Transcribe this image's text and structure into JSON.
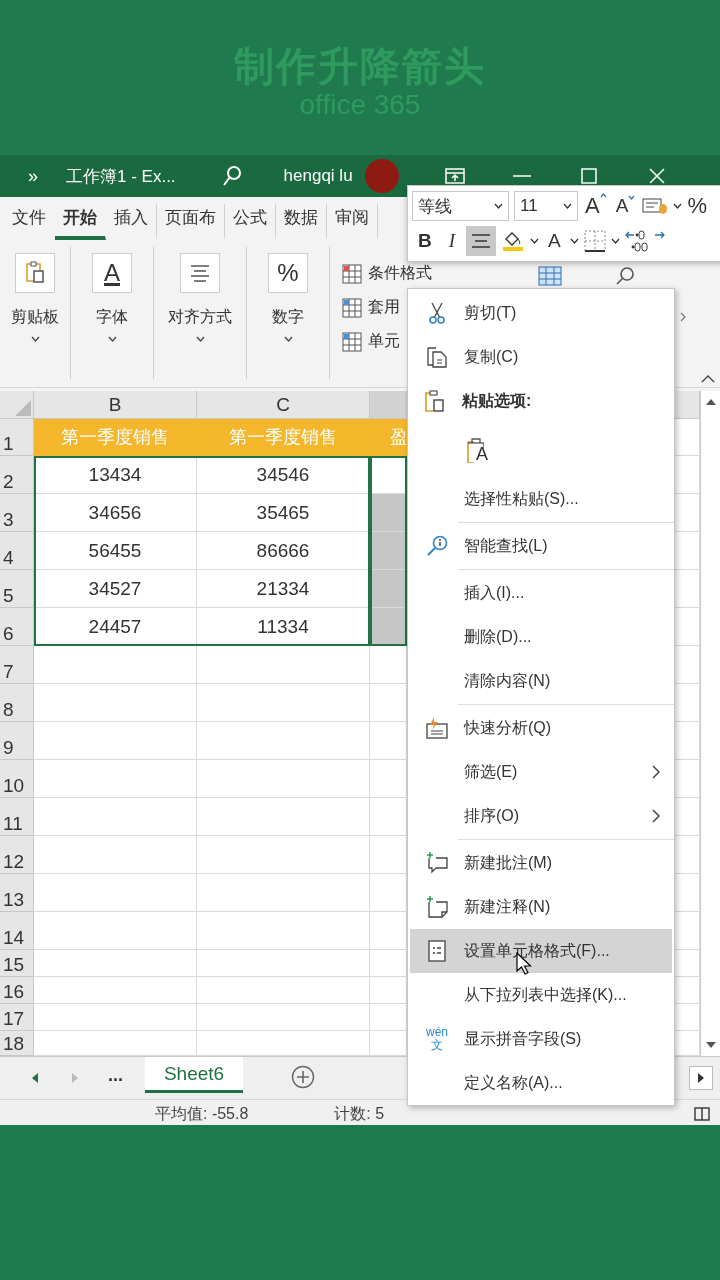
{
  "banner": {
    "title": "制作升降箭头",
    "subtitle": "office 365"
  },
  "title_bar": {
    "overflow": "»",
    "document": "工作簿1 - Ex...",
    "user": "hengqi lu"
  },
  "tabs": [
    {
      "label": "文件",
      "selected": false
    },
    {
      "label": "开始",
      "selected": true
    },
    {
      "label": "插入",
      "selected": false
    },
    {
      "label": "页面布",
      "selected": false
    },
    {
      "label": "公式",
      "selected": false
    },
    {
      "label": "数据",
      "selected": false
    },
    {
      "label": "审阅",
      "selected": false
    }
  ],
  "ribbon": {
    "groups": [
      {
        "label": "剪贴板",
        "kind": "clipboard"
      },
      {
        "label": "字体",
        "kind": "glyph",
        "glyph": "A"
      },
      {
        "label": "对齐方式",
        "kind": "align"
      },
      {
        "label": "数字",
        "kind": "glyph",
        "glyph": "%"
      }
    ],
    "styles": [
      "条件格式",
      "套用",
      "单元"
    ]
  },
  "mini_toolbar": {
    "font": "等线",
    "size": "11",
    "grow": "A",
    "shrink": "A",
    "percent": "%",
    "bold": "B",
    "italic": "I",
    "font_color": "A",
    "center_selected": true
  },
  "sheet": {
    "columns": [
      "B",
      "C"
    ],
    "rows": [
      {
        "number": "1",
        "kind": "header",
        "cells": [
          "第一季度销售",
          "第一季度销售",
          "盈"
        ],
        "selected": false
      },
      {
        "number": "2",
        "kind": "data",
        "cells": [
          "13434",
          "34546"
        ],
        "selected": false
      },
      {
        "number": "3",
        "kind": "data",
        "cells": [
          "34656",
          "35465"
        ],
        "selected": true
      },
      {
        "number": "4",
        "kind": "data",
        "cells": [
          "56455",
          "86666"
        ],
        "selected": true
      },
      {
        "number": "5",
        "kind": "data",
        "cells": [
          "34527",
          "21334"
        ],
        "selected": true
      },
      {
        "number": "6",
        "kind": "data",
        "cells": [
          "24457",
          "11334"
        ],
        "selected": true
      },
      {
        "number": "7",
        "kind": "empty",
        "selected": false
      },
      {
        "number": "8",
        "kind": "empty",
        "selected": false
      },
      {
        "number": "9",
        "kind": "empty",
        "selected": false
      },
      {
        "number": "10",
        "kind": "empty",
        "selected": false
      },
      {
        "number": "11",
        "kind": "empty",
        "selected": false
      },
      {
        "number": "12",
        "kind": "empty",
        "selected": false
      },
      {
        "number": "13",
        "kind": "empty",
        "selected": false
      },
      {
        "number": "14",
        "kind": "empty",
        "selected": false
      },
      {
        "number": "15",
        "kind": "empty",
        "selected": false
      },
      {
        "number": "16",
        "kind": "empty",
        "selected": false
      },
      {
        "number": "17",
        "kind": "empty",
        "selected": false
      },
      {
        "number": "18",
        "kind": "empty",
        "selected": false
      }
    ]
  },
  "sheet_tabs": {
    "more": "...",
    "tabs": [
      {
        "label": "Sheet6",
        "selected": true
      }
    ]
  },
  "status_bar": {
    "average": "平均值: -55.8",
    "count": "计数: 5"
  },
  "context_menu": [
    {
      "kind": "command",
      "label": "剪切(T)",
      "submenu": false,
      "selected": false
    },
    {
      "kind": "command",
      "label": "复制(C)",
      "submenu": false,
      "selected": false
    },
    {
      "kind": "header",
      "label": "粘贴选项:"
    },
    {
      "kind": "paste_option",
      "glyph": "A"
    },
    {
      "kind": "command",
      "label": "选择性粘贴(S)...",
      "submenu": false,
      "selected": false
    },
    {
      "kind": "separator"
    },
    {
      "kind": "command",
      "label": "智能查找(L)",
      "submenu": false,
      "selected": false
    },
    {
      "kind": "separator"
    },
    {
      "kind": "command",
      "label": "插入(I)...",
      "submenu": false,
      "selected": false
    },
    {
      "kind": "command",
      "label": "删除(D)...",
      "submenu": false,
      "selected": false
    },
    {
      "kind": "command",
      "label": "清除内容(N)",
      "submenu": false,
      "selected": false
    },
    {
      "kind": "separator"
    },
    {
      "kind": "command",
      "label": "快速分析(Q)",
      "submenu": false,
      "selected": false
    },
    {
      "kind": "command",
      "label": "筛选(E)",
      "submenu": true,
      "selected": false
    },
    {
      "kind": "command",
      "label": "排序(O)",
      "submenu": true,
      "selected": false
    },
    {
      "kind": "separator"
    },
    {
      "kind": "command",
      "label": "新建批注(M)",
      "submenu": false,
      "selected": false
    },
    {
      "kind": "command",
      "label": "新建注释(N)",
      "submenu": false,
      "selected": false
    },
    {
      "kind": "command",
      "label": "设置单元格格式(F)...",
      "submenu": false,
      "selected": true
    },
    {
      "kind": "command",
      "label": "从下拉列表中选择(K)...",
      "submenu": false,
      "selected": false
    },
    {
      "kind": "command",
      "label": "显示拼音字段(S)",
      "submenu": false,
      "selected": false,
      "badge": [
        "wén",
        "文"
      ]
    },
    {
      "kind": "command",
      "label": "定义名称(A)...",
      "submenu": false,
      "selected": false
    }
  ]
}
